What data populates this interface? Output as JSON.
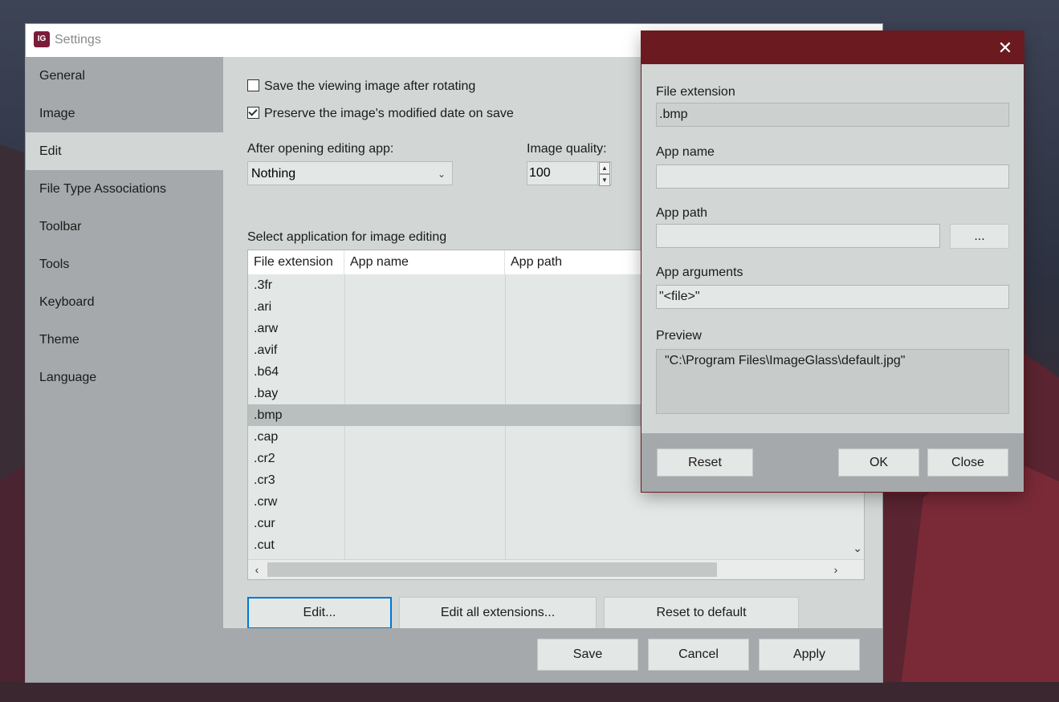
{
  "window": {
    "title": "Settings",
    "app_icon_text": "IG"
  },
  "sidebar": {
    "items": [
      {
        "label": "General"
      },
      {
        "label": "Image"
      },
      {
        "label": "Edit"
      },
      {
        "label": "File Type Associations"
      },
      {
        "label": "Toolbar"
      },
      {
        "label": "Tools"
      },
      {
        "label": "Keyboard"
      },
      {
        "label": "Theme"
      },
      {
        "label": "Language"
      }
    ],
    "active": "Edit"
  },
  "edit": {
    "save_after_rotating": {
      "label": "Save the viewing image after rotating",
      "checked": false
    },
    "preserve_date": {
      "label": "Preserve the image's modified date on save",
      "checked": true
    },
    "after_opening_label": "After opening editing app:",
    "after_opening_value": "Nothing",
    "image_quality_label": "Image quality:",
    "image_quality_value": "100",
    "select_app_label": "Select application for image editing",
    "table": {
      "columns": [
        "File extension",
        "App name",
        "App path"
      ],
      "rows": [
        ".3fr",
        ".ari",
        ".arw",
        ".avif",
        ".b64",
        ".bay",
        ".bmp",
        ".cap",
        ".cr2",
        ".cr3",
        ".crw",
        ".cur",
        ".cut"
      ],
      "selected": ".bmp"
    },
    "buttons": {
      "edit": "Edit...",
      "edit_all": "Edit all extensions...",
      "reset_default": "Reset to default"
    }
  },
  "footer": {
    "save": "Save",
    "cancel": "Cancel",
    "apply": "Apply"
  },
  "dialog": {
    "close_glyph": "✕",
    "file_extension_label": "File extension",
    "file_extension_value": ".bmp",
    "app_name_label": "App name",
    "app_name_value": "",
    "app_path_label": "App path",
    "app_path_value": "",
    "browse_label": "...",
    "app_arguments_label": "App arguments",
    "app_arguments_value": "\"<file>\"",
    "preview_label": "Preview",
    "preview_value": "\"C:\\Program Files\\ImageGlass\\default.jpg\"",
    "reset": "Reset",
    "ok": "OK",
    "close": "Close"
  },
  "colors": {
    "accent": "#0078d7",
    "dialog_titlebar": "#6b1a1f",
    "app_icon": "#7a1d3a"
  }
}
